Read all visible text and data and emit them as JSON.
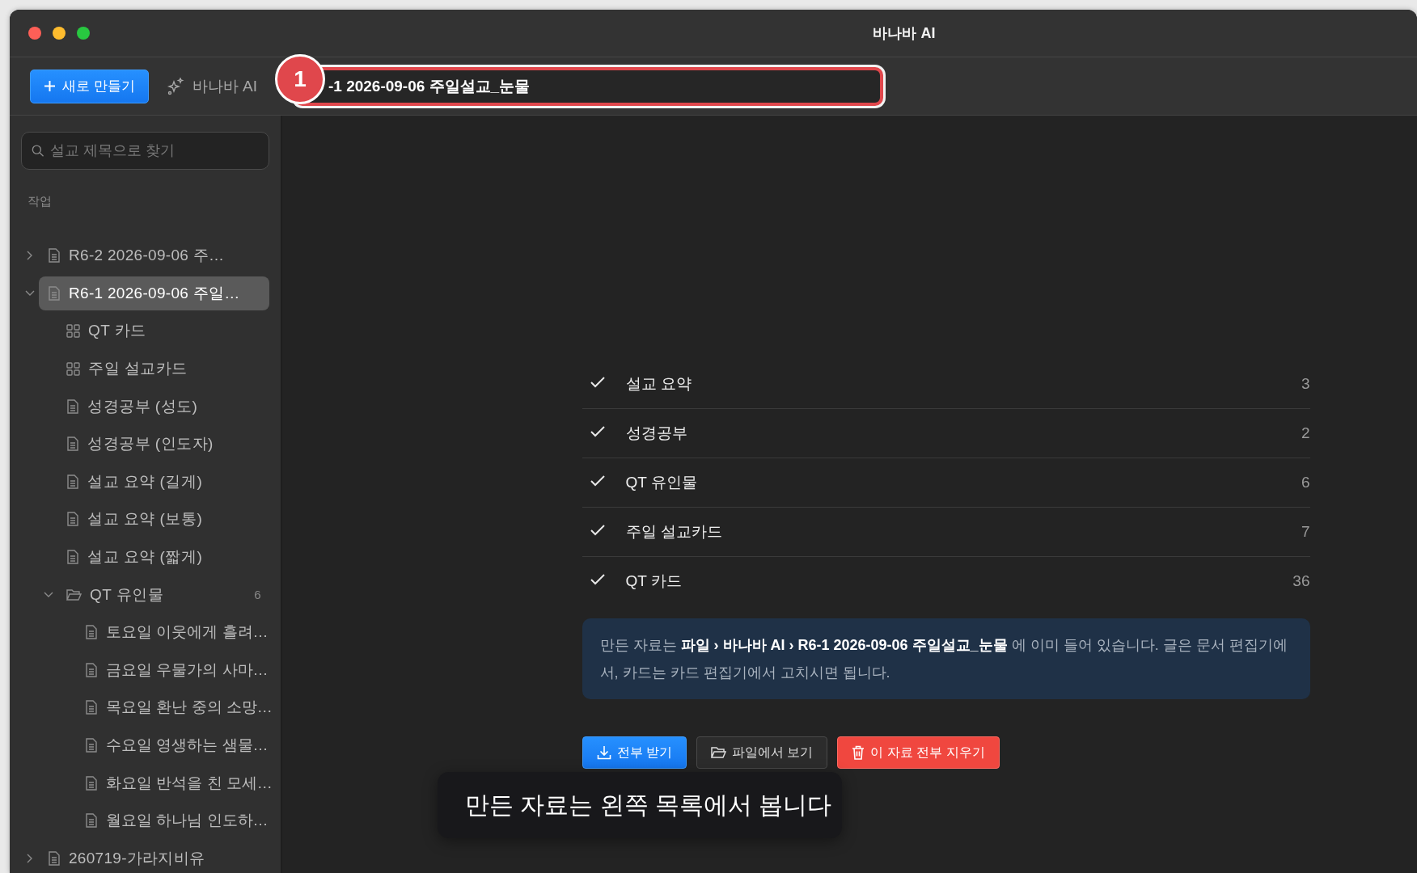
{
  "window": {
    "title": "바나바 AI"
  },
  "toolbar": {
    "new_button": "새로 만들기",
    "ai_button": "바나바 AI",
    "title_field": {
      "value": "-1 2026-09-06 주일설교_눈물"
    },
    "step_badge": "1"
  },
  "sidebar": {
    "search": {
      "placeholder": "설교 제목으로 찾기"
    },
    "section": "작업",
    "items": [
      {
        "label": "R6-2 2026-09-06 주…",
        "kind": "doc",
        "expanded": false,
        "selected": false
      },
      {
        "label": "R6-1 2026-09-06 주일…",
        "kind": "doc",
        "expanded": true,
        "selected": true,
        "children": [
          {
            "label": "QT 카드",
            "kind": "card",
            "selected": false
          },
          {
            "label": "주일 설교카드",
            "kind": "card",
            "selected": false
          },
          {
            "label": "성경공부 (성도)",
            "kind": "doc",
            "selected": false
          },
          {
            "label": "성경공부 (인도자)",
            "kind": "doc",
            "selected": false
          },
          {
            "label": "설교 요약 (길게)",
            "kind": "doc",
            "selected": false
          },
          {
            "label": "설교 요약 (보통)",
            "kind": "doc",
            "selected": false
          },
          {
            "label": "설교 요약 (짧게)",
            "kind": "doc",
            "selected": false
          },
          {
            "label": "QT 유인물",
            "kind": "folder",
            "expanded": true,
            "selected": false,
            "count": "6",
            "children": [
              {
                "label": "토요일 이웃에게 흘려…",
                "kind": "doc",
                "selected": false
              },
              {
                "label": "금요일 우물가의 사마…",
                "kind": "doc",
                "selected": false
              },
              {
                "label": "목요일 환난 중의 소망…",
                "kind": "doc",
                "selected": false
              },
              {
                "label": "수요일 영생하는 샘물…",
                "kind": "doc",
                "selected": false
              },
              {
                "label": "화요일 반석을 친 모세…",
                "kind": "doc",
                "selected": false
              },
              {
                "label": "월요일 하나님 인도하…",
                "kind": "doc",
                "selected": false
              }
            ]
          }
        ]
      },
      {
        "label": "260719-가라지비유",
        "kind": "doc",
        "expanded": false,
        "selected": false
      }
    ]
  },
  "summary": {
    "rows": [
      {
        "label": "설교 요약",
        "count": "3",
        "checked": true
      },
      {
        "label": "성경공부",
        "count": "2",
        "checked": true
      },
      {
        "label": "QT 유인물",
        "count": "6",
        "checked": true
      },
      {
        "label": "주일 설교카드",
        "count": "7",
        "checked": true
      },
      {
        "label": "QT 카드",
        "count": "36",
        "checked": true
      }
    ],
    "notice": "만든 자료는 **파일 › 바나바 AI › R6-1 2026-09-06 주일설교_눈물** 에 이미 들어 있습니다. 글은 문서 편집기에서, 카드는 카드 편집기에서 고치시면 됩니다.",
    "actions": [
      {
        "label": "전부 받기",
        "kind": "primary"
      },
      {
        "label": "파일에서 보기",
        "kind": "default"
      },
      {
        "label": "이 자료 전부 지우기",
        "kind": "danger"
      }
    ]
  },
  "tooltip": "만든 자료는 왼쪽 목록에서 봅니다"
}
